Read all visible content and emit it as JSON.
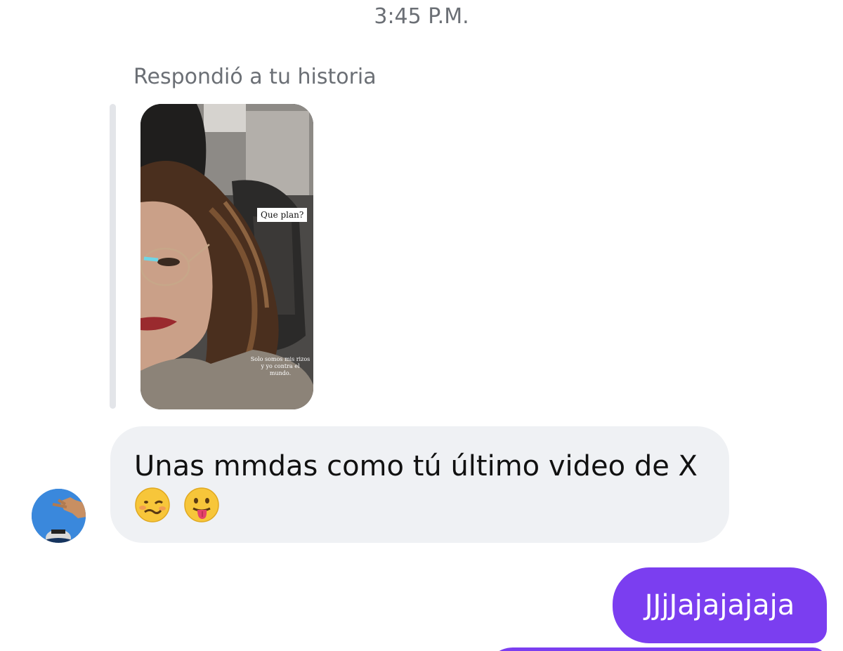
{
  "timestamp": "3:45 P.M.",
  "reply": {
    "note": "Respondió a tu historia",
    "story": {
      "sticker_text": "Que plan?",
      "caption": "Solo somos mis rizos y yo contra el mundo."
    }
  },
  "messages": [
    {
      "direction": "incoming",
      "text": "Unas mmdas como tú último video de X",
      "emojis": [
        "woozy-face",
        "face-with-tongue"
      ]
    },
    {
      "direction": "outgoing",
      "text": "JJjJajajajaja"
    }
  ],
  "colors": {
    "outgoing_bubble": "#7b3ef0",
    "incoming_bubble": "#eff1f4",
    "meta_text": "#6b6f75"
  }
}
